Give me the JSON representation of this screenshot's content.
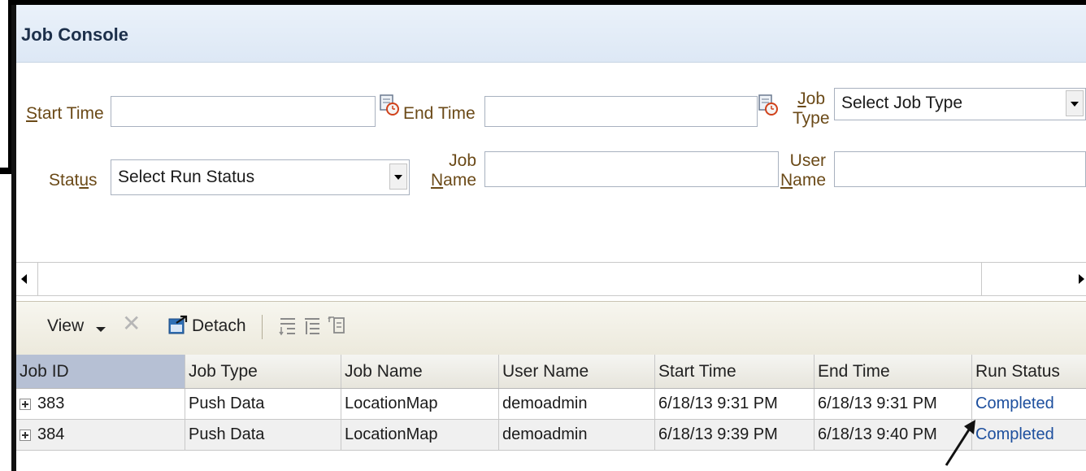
{
  "title": "Job Console",
  "filters": {
    "start_time": {
      "label_first": "S",
      "label_rest": "tart Time",
      "value": ""
    },
    "end_time": {
      "label": "End Time",
      "value": ""
    },
    "job_type": {
      "label_first": "J",
      "label_rest": "ob",
      "label_line2": "Type",
      "selected": "Select Job Type"
    },
    "status": {
      "label_head": "Stat",
      "label_ul": "u",
      "label_tail": "s",
      "selected": "Select Run Status"
    },
    "job_name": {
      "label_line1": "Job",
      "label_ul": "N",
      "label_rest": "ame",
      "value": ""
    },
    "user_name": {
      "label_line1": "User",
      "label_ul": "N",
      "label_rest": "ame",
      "value": ""
    }
  },
  "toolbar": {
    "view_label": "View",
    "detach_label": "Detach",
    "icons": [
      "delete-icon",
      "detach-icon",
      "wrap-icon",
      "freeze-icon",
      "reorder-icon"
    ]
  },
  "table": {
    "columns": [
      "Job ID",
      "Job Type",
      "Job Name",
      "User Name",
      "Start Time",
      "End Time",
      "Run Status"
    ],
    "rows": [
      {
        "job_id": "383",
        "job_type": "Push Data",
        "job_name": "LocationMap",
        "user_name": "demoadmin",
        "start_time": "6/18/13 9:31 PM",
        "end_time": "6/18/13 9:31 PM",
        "run_status": "Completed"
      },
      {
        "job_id": "384",
        "job_type": "Push Data",
        "job_name": "LocationMap",
        "user_name": "demoadmin",
        "start_time": "6/18/13 9:39 PM",
        "end_time": "6/18/13 9:40 PM",
        "run_status": "Completed"
      }
    ]
  },
  "colors": {
    "label": "#6b4a18",
    "link": "#1d4f9e",
    "header_selected": "#b6c0d4",
    "title_bar": "#dde8f5"
  }
}
